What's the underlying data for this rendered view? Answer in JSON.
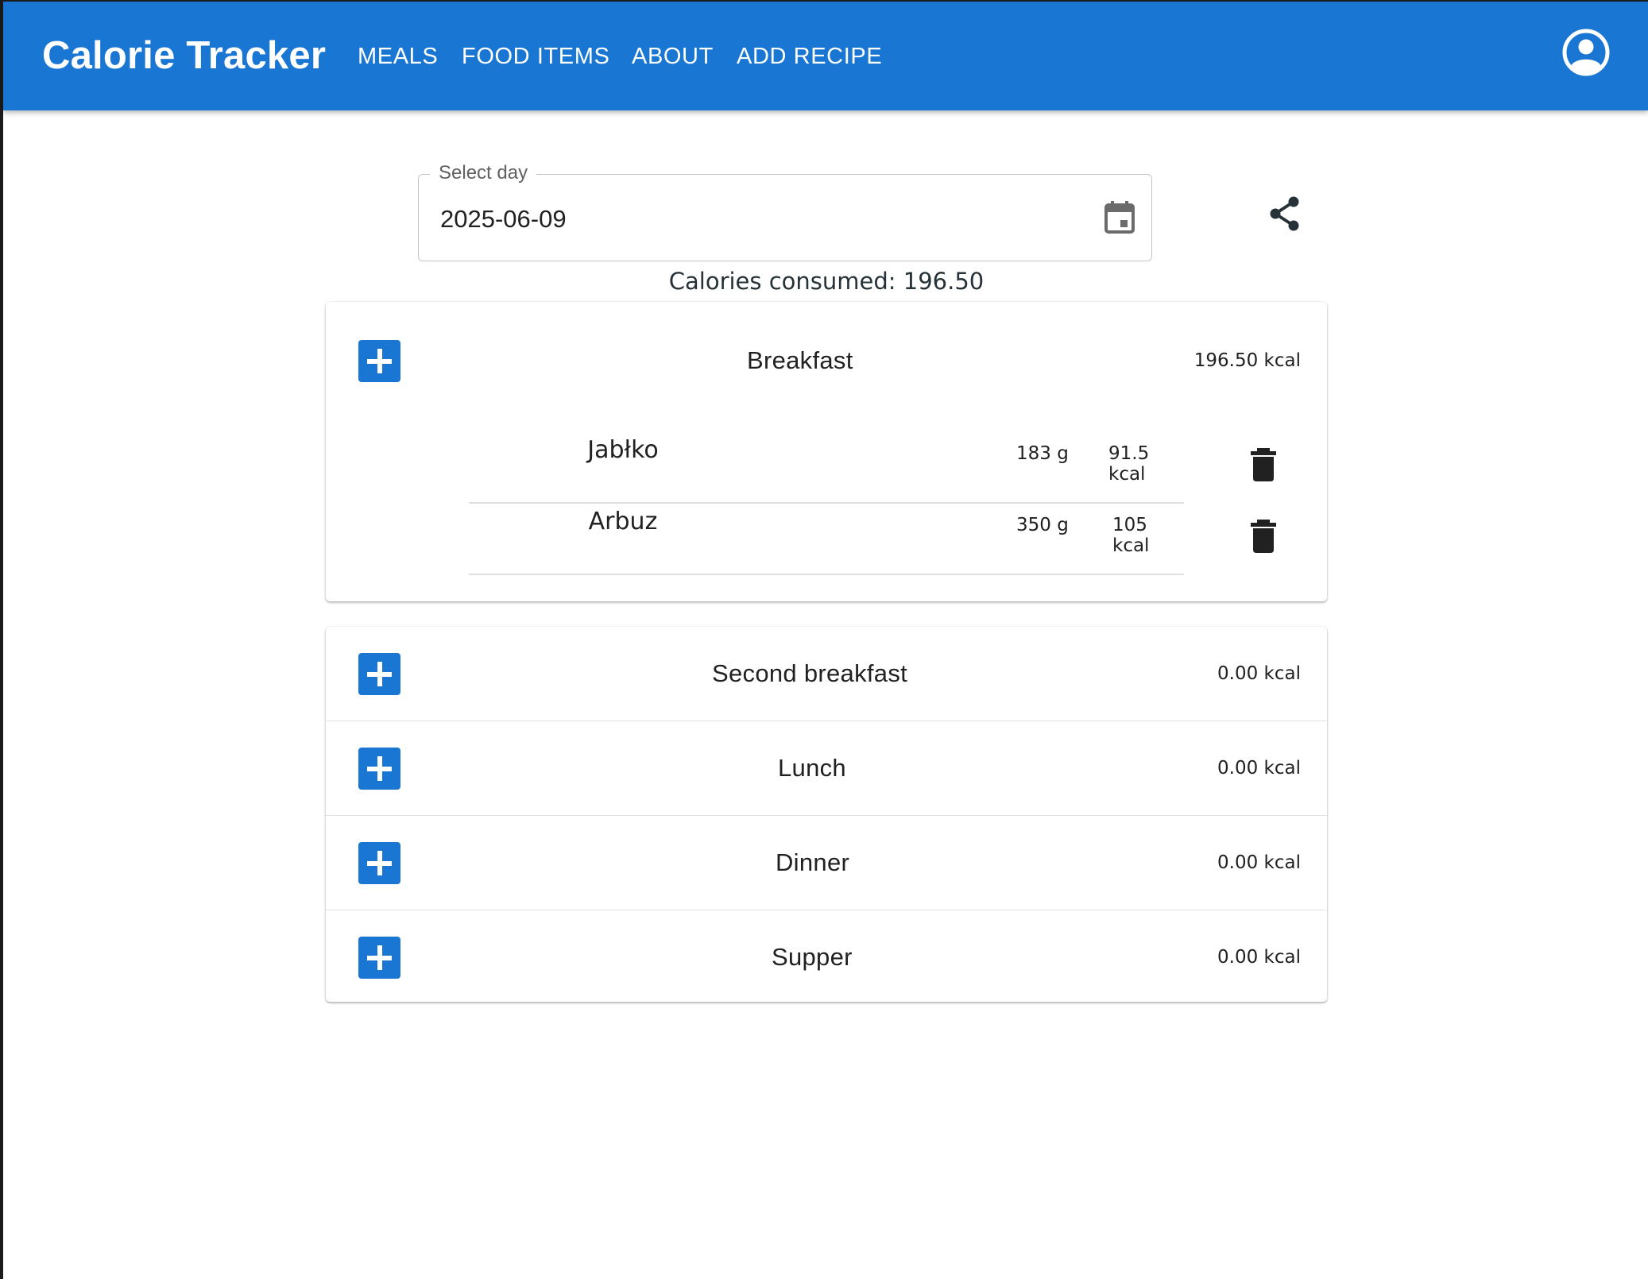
{
  "app": {
    "title": "Calorie Tracker",
    "nav": [
      "MEALS",
      "FOOD ITEMS",
      "ABOUT",
      "ADD RECIPE"
    ],
    "account_icon": "account-circle-icon",
    "primary_color": "#1976d2"
  },
  "date_picker": {
    "label": "Select day",
    "value": "2025-06-09",
    "icon": "calendar-icon"
  },
  "share_icon": "share-icon",
  "summary": {
    "label": "Calories consumed:",
    "value": "196.50"
  },
  "meals": [
    {
      "name": "Breakfast",
      "kcal": "196.50 kcal",
      "items": [
        {
          "name": "Jabłko",
          "grams": "183 g",
          "kcal": "91.5 kcal"
        },
        {
          "name": "Arbuz",
          "grams": "350 g",
          "kcal": "105 kcal"
        }
      ]
    },
    {
      "name": "Second breakfast",
      "kcal": "0.00 kcal",
      "items": []
    },
    {
      "name": "Lunch",
      "kcal": "0.00 kcal",
      "items": []
    },
    {
      "name": "Dinner",
      "kcal": "0.00 kcal",
      "items": []
    },
    {
      "name": "Supper",
      "kcal": "0.00 kcal",
      "items": []
    }
  ],
  "icons": {
    "add": "plus-icon",
    "delete": "trash-icon"
  }
}
